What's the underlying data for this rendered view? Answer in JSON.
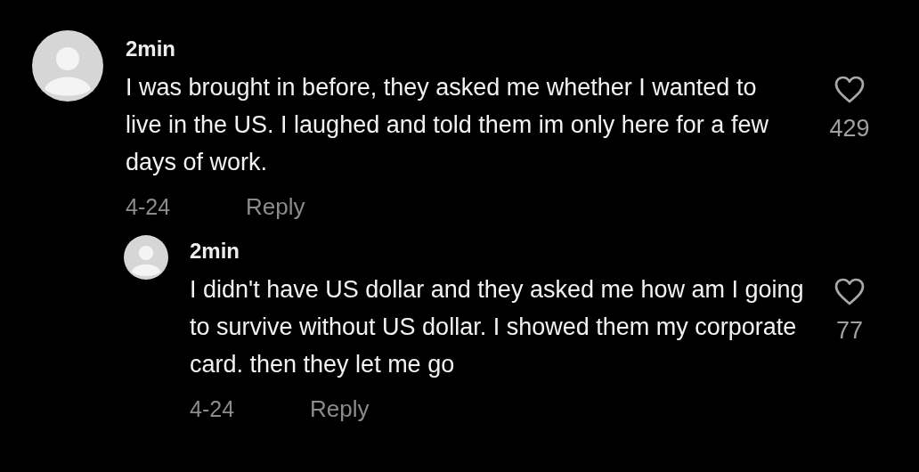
{
  "comments": [
    {
      "username": "2min",
      "text": "I was brought in before, they asked me whether I wanted to live in the US. I laughed and told them im only here for a few days of work.",
      "date": "4-24",
      "reply_label": "Reply",
      "likes": "429",
      "liked": false,
      "children": [
        {
          "username": "2min",
          "text": "I didn't have US dollar and they asked me how am I going to survive without US dollar. I showed them my corporate card. then they let me go",
          "date": "4-24",
          "reply_label": "Reply",
          "likes": "77",
          "liked": false
        }
      ]
    }
  ]
}
